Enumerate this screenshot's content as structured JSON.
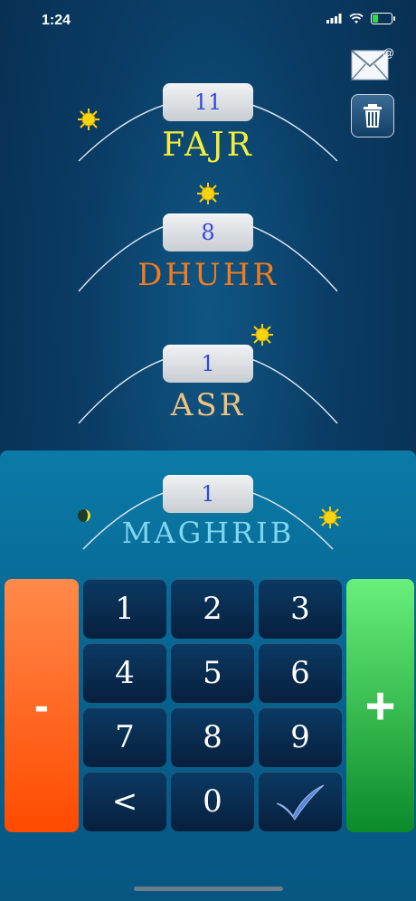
{
  "status_bar": {
    "time": "1:24"
  },
  "prayers": [
    {
      "name": "FAJR",
      "count": "11",
      "color": "#f2ee3b"
    },
    {
      "name": "DHUHR",
      "count": "8",
      "color": "#f27b1d"
    },
    {
      "name": "ASR",
      "count": "1",
      "color": "#f2c27e"
    },
    {
      "name": "MAGHRIB",
      "count": "1",
      "color": "#7fd6f0"
    }
  ],
  "keypad": {
    "minus_label": "-",
    "plus_label": "+",
    "keys": [
      "1",
      "2",
      "3",
      "4",
      "5",
      "6",
      "7",
      "8",
      "9",
      "<",
      "0"
    ],
    "confirm_icon": "checkmark-icon"
  },
  "icons": {
    "mail": "mail-icon",
    "trash": "trash-icon",
    "sun": "sun-icon",
    "moon": "moon-icon"
  },
  "colors": {
    "background_top": "#0f5685",
    "panel": "#0b7aa7",
    "minus": "#ff5a0a",
    "plus": "#1aa33a",
    "counter_text": "#3449d8"
  }
}
